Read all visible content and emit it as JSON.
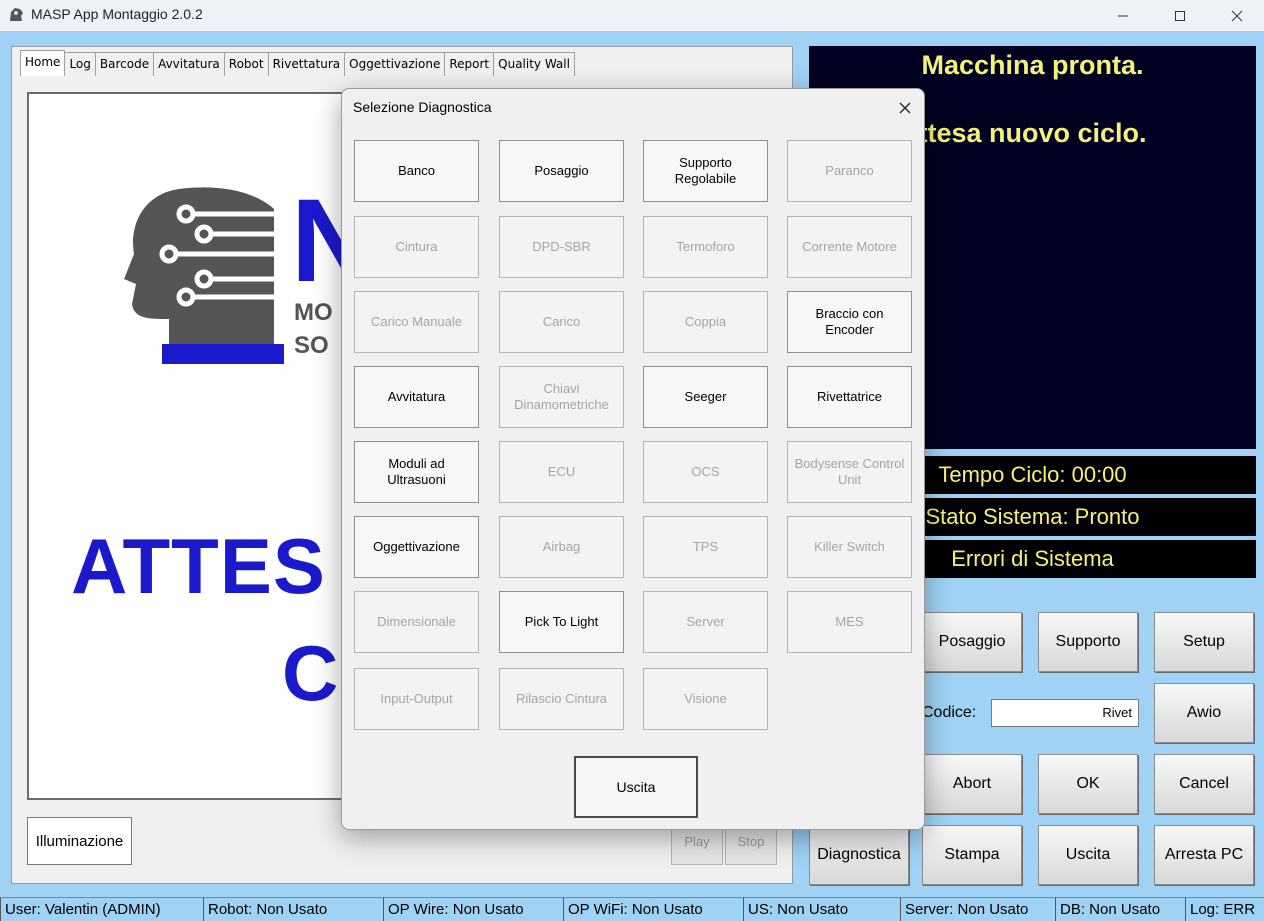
{
  "window": {
    "title": "MASP App Montaggio 2.0.2",
    "minimize_icon": "minimize-icon",
    "maximize_icon": "maximize-icon",
    "close_icon": "close-icon"
  },
  "tabs": [
    "Home",
    "Log",
    "Barcode",
    "Avvitatura",
    "Robot",
    "Rivettatura",
    "Oggettivazione",
    "Report",
    "Quality Wall"
  ],
  "home": {
    "logo_letter": "N",
    "logo_sub1": "MO",
    "logo_sub2": "SO",
    "attesa_line1": "ATTES",
    "attesa_line2": "C",
    "illuminazione": "Illuminazione",
    "play": "Play",
    "stop": "Stop"
  },
  "messages": {
    "line1": "Macchina pronta.",
    "line2": "ttesa nuovo ciclo."
  },
  "status": {
    "tempo": "Tempo Ciclo: 00:00",
    "stato": "Stato Sistema: Pronto",
    "errori": "Errori di Sistema"
  },
  "right_buttons": {
    "posaggio": "Posaggio",
    "supporto": "Supporto",
    "setup": "Setup",
    "avvio": "Awio",
    "abort": "Abort",
    "ok": "OK",
    "cancel": "Cancel",
    "diagnostica": "Diagnostica",
    "stampa": "Stampa",
    "uscita": "Uscita",
    "arresta": "Arresta PC"
  },
  "codice": {
    "label": "Codice:",
    "value": "Rivet"
  },
  "statusbar": [
    "User: Valentin (ADMIN)",
    "Robot: Non Usato",
    "OP Wire: Non Usato",
    "OP WiFi: Non Usato",
    "US: Non Usato",
    "Server: Non Usato",
    "DB: Non Usato",
    "Log: ERR"
  ],
  "dialog": {
    "title": "Selezione Diagnostica",
    "exit": "Uscita",
    "buttons": [
      {
        "label": "Banco",
        "enabled": true
      },
      {
        "label": "Posaggio",
        "enabled": true
      },
      {
        "label": "Supporto Regolabile",
        "enabled": true
      },
      {
        "label": "Paranco",
        "enabled": false
      },
      {
        "label": "Cintura",
        "enabled": false
      },
      {
        "label": "DPD-SBR",
        "enabled": false
      },
      {
        "label": "Termoforo",
        "enabled": false
      },
      {
        "label": "Corrente Motore",
        "enabled": false
      },
      {
        "label": "Carico Manuale",
        "enabled": false
      },
      {
        "label": "Carico",
        "enabled": false
      },
      {
        "label": "Coppia",
        "enabled": false
      },
      {
        "label": "Braccio con Encoder",
        "enabled": true
      },
      {
        "label": "Avvitatura",
        "enabled": true
      },
      {
        "label": "Chiavi Dinamometriche",
        "enabled": false
      },
      {
        "label": "Seeger",
        "enabled": true
      },
      {
        "label": "Rivettatrice",
        "enabled": true
      },
      {
        "label": "Moduli ad Ultrasuoni",
        "enabled": true
      },
      {
        "label": "ECU",
        "enabled": false
      },
      {
        "label": "OCS",
        "enabled": false
      },
      {
        "label": "Bodysense Control Unit",
        "enabled": false
      },
      {
        "label": "Oggettivazione",
        "enabled": true
      },
      {
        "label": "Airbag",
        "enabled": false
      },
      {
        "label": "TPS",
        "enabled": false
      },
      {
        "label": "Killer Switch",
        "enabled": false
      },
      {
        "label": "Dimensionale",
        "enabled": false
      },
      {
        "label": "Pick To Light",
        "enabled": true
      },
      {
        "label": "Server",
        "enabled": false
      },
      {
        "label": "MES",
        "enabled": false
      },
      {
        "label": "Input-Output",
        "enabled": false
      },
      {
        "label": "Rilascio Cintura",
        "enabled": false
      },
      {
        "label": "Visione",
        "enabled": false
      }
    ]
  }
}
